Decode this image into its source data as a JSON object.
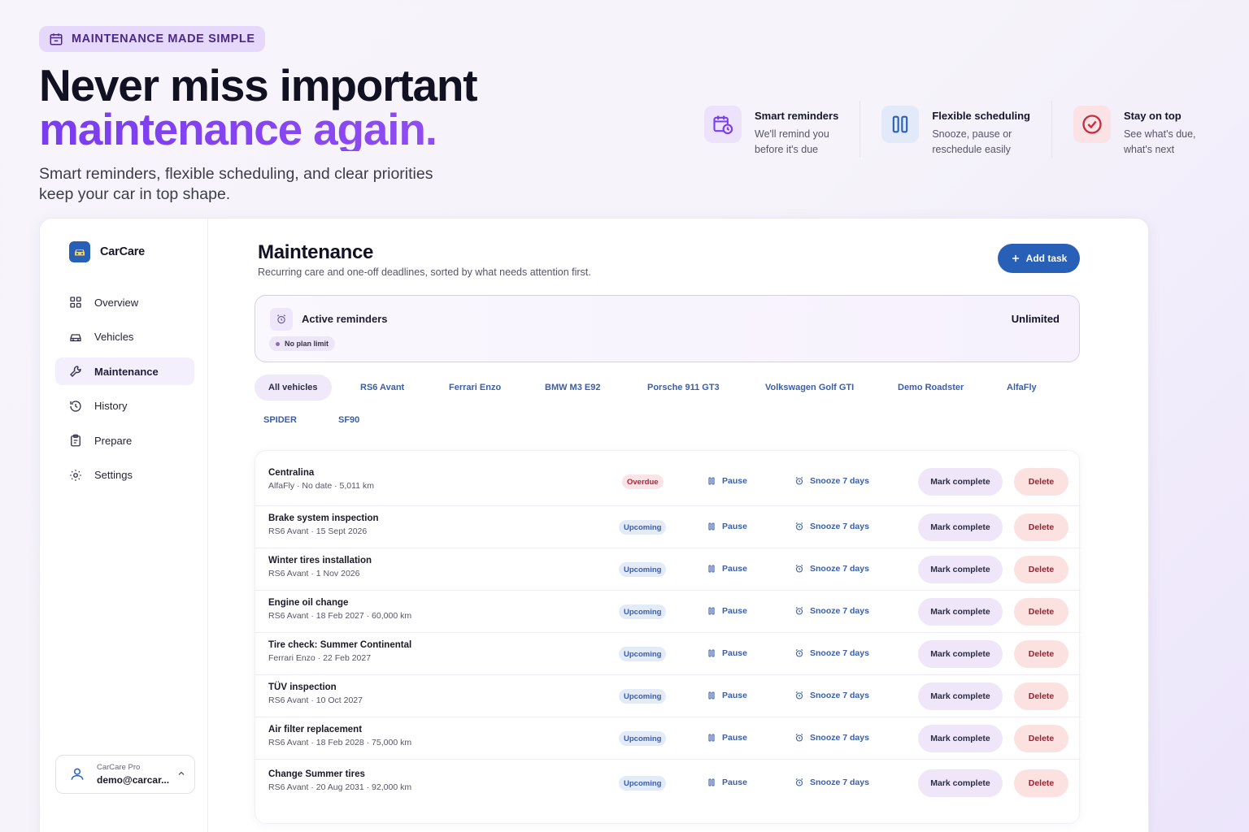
{
  "hero": {
    "badge": "MAINTENANCE MADE SIMPLE",
    "title_line1": "Never miss important",
    "title_line2": "maintenance again.",
    "subtitle": "Smart reminders, flexible scheduling, and clear priorities keep your car in top shape."
  },
  "features": [
    {
      "icon": "calendar-clock-icon",
      "title": "Smart reminders",
      "desc": "We'll remind you before it's due",
      "accent": "#7a3cf0"
    },
    {
      "icon": "pause-columns-icon",
      "title": "Flexible scheduling",
      "desc": "Snooze, pause or reschedule easily",
      "accent": "#2860b8"
    },
    {
      "icon": "check-circle-icon",
      "title": "Stay on top",
      "desc": "See what's due, what's next",
      "accent": "#c62c42"
    }
  ],
  "sidebar": {
    "brand": "CarCare",
    "items": [
      {
        "label": "Overview",
        "icon": "grid-icon",
        "active": false
      },
      {
        "label": "Vehicles",
        "icon": "car-icon",
        "active": false
      },
      {
        "label": "Maintenance",
        "icon": "wrench-icon",
        "active": true
      },
      {
        "label": "History",
        "icon": "history-icon",
        "active": false
      },
      {
        "label": "Prepare",
        "icon": "clipboard-icon",
        "active": false
      },
      {
        "label": "Settings",
        "icon": "gear-icon",
        "active": false
      }
    ],
    "account": {
      "plan": "CarCare Pro",
      "email": "demo@carcar..."
    }
  },
  "main": {
    "title": "Maintenance",
    "subtitle": "Recurring care and one-off deadlines, sorted by what needs attention first.",
    "add_button": "Add task",
    "reminders": {
      "title": "Active reminders",
      "value": "Unlimited",
      "pill": "No plan limit"
    },
    "vehicle_tabs": [
      "All vehicles",
      "RS6 Avant",
      "Ferrari Enzo",
      "BMW M3 E92",
      "Porsche 911 GT3",
      "Volkswagen Golf GTI",
      "Demo Roadster",
      "AlfaFly",
      "SPIDER",
      "SF90"
    ],
    "actions": {
      "pause": "Pause",
      "snooze": "Snooze 7 days",
      "complete": "Mark complete",
      "delete": "Delete"
    },
    "tasks": [
      {
        "name": "Centralina",
        "meta": "AlfaFly · No date · 5,011 km",
        "status": "Overdue"
      },
      {
        "name": "Brake system inspection",
        "meta": "RS6 Avant · 15 Sept 2026",
        "status": "Upcoming"
      },
      {
        "name": "Winter tires installation",
        "meta": "RS6 Avant · 1 Nov 2026",
        "status": "Upcoming"
      },
      {
        "name": "Engine oil change",
        "meta": "RS6 Avant · 18 Feb 2027 · 60,000 km",
        "status": "Upcoming"
      },
      {
        "name": "Tire check: Summer Continental",
        "meta": "Ferrari Enzo · 22 Feb 2027",
        "status": "Upcoming"
      },
      {
        "name": "TÜV inspection",
        "meta": "RS6 Avant · 10 Oct 2027",
        "status": "Upcoming"
      },
      {
        "name": "Air filter replacement",
        "meta": "RS6 Avant · 18 Feb 2028 · 75,000 km",
        "status": "Upcoming"
      },
      {
        "name": "Change Summer tires",
        "meta": "RS6 Avant · 20 Aug 2031 · 92,000 km",
        "status": "Upcoming"
      }
    ]
  }
}
